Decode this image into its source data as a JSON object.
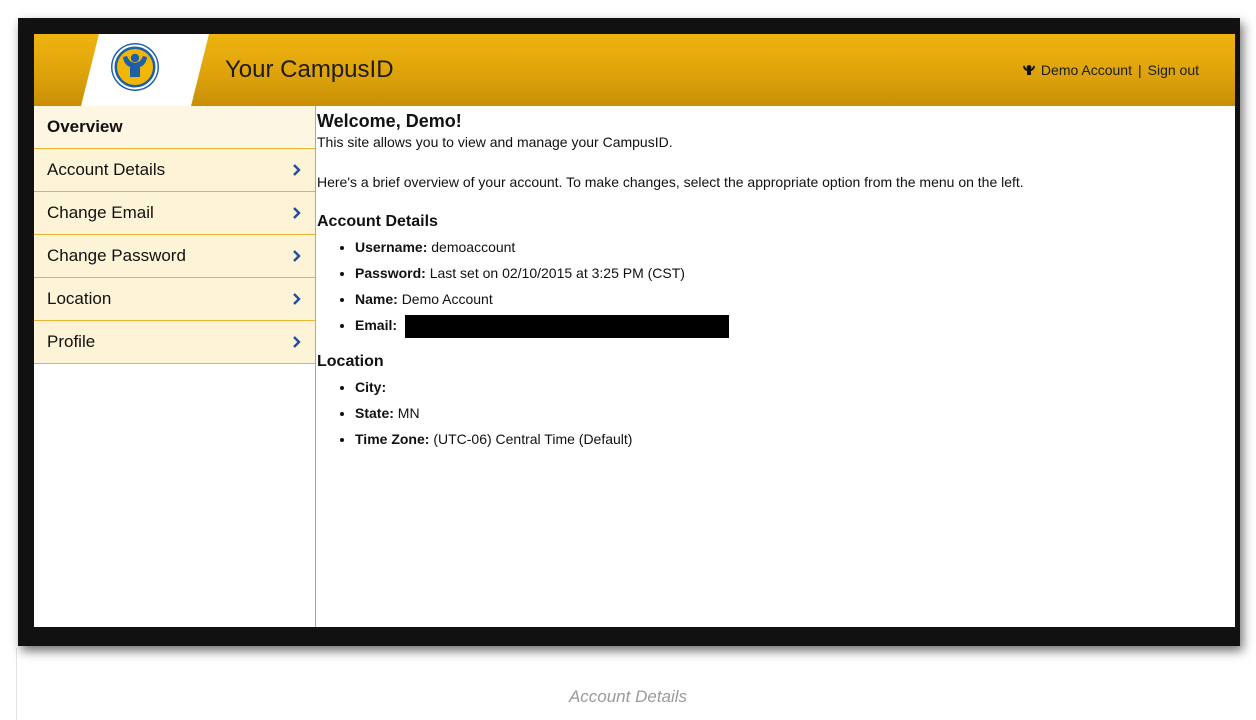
{
  "header": {
    "app_title": "Your CampusID",
    "user_name": "Demo Account",
    "separator": "|",
    "sign_out": "Sign out"
  },
  "sidebar": {
    "items": [
      {
        "label": "Overview",
        "active": true
      },
      {
        "label": "Account Details",
        "active": false
      },
      {
        "label": "Change Email",
        "active": false
      },
      {
        "label": "Change Password",
        "active": false
      },
      {
        "label": "Location",
        "active": false
      },
      {
        "label": "Profile",
        "active": false
      }
    ]
  },
  "main": {
    "welcome": "Welcome, Demo!",
    "intro": "This site allows you to view and manage your CampusID.",
    "overview_text": "Here's a brief overview of your account. To make changes, select the appropriate option from the menu on the left.",
    "account_details": {
      "heading": "Account Details",
      "username_label": "Username:",
      "username_value": "demoaccount",
      "password_label": "Password:",
      "password_value": "Last set on 02/10/2015 at 3:25 PM (CST)",
      "name_label": "Name:",
      "name_value": "Demo Account",
      "email_label": "Email:"
    },
    "location": {
      "heading": "Location",
      "city_label": "City:",
      "city_value": "",
      "state_label": "State:",
      "state_value": "MN",
      "timezone_label": "Time Zone:",
      "timezone_value": "(UTC-06) Central Time (Default)"
    }
  },
  "caption": "Account Details",
  "colors": {
    "header_gold": "#deA30b",
    "nav_bg": "#fdf3d6",
    "nav_border": "#e9b331",
    "logo_blue": "#1f5fa8",
    "logo_yellow": "#f2b705"
  }
}
